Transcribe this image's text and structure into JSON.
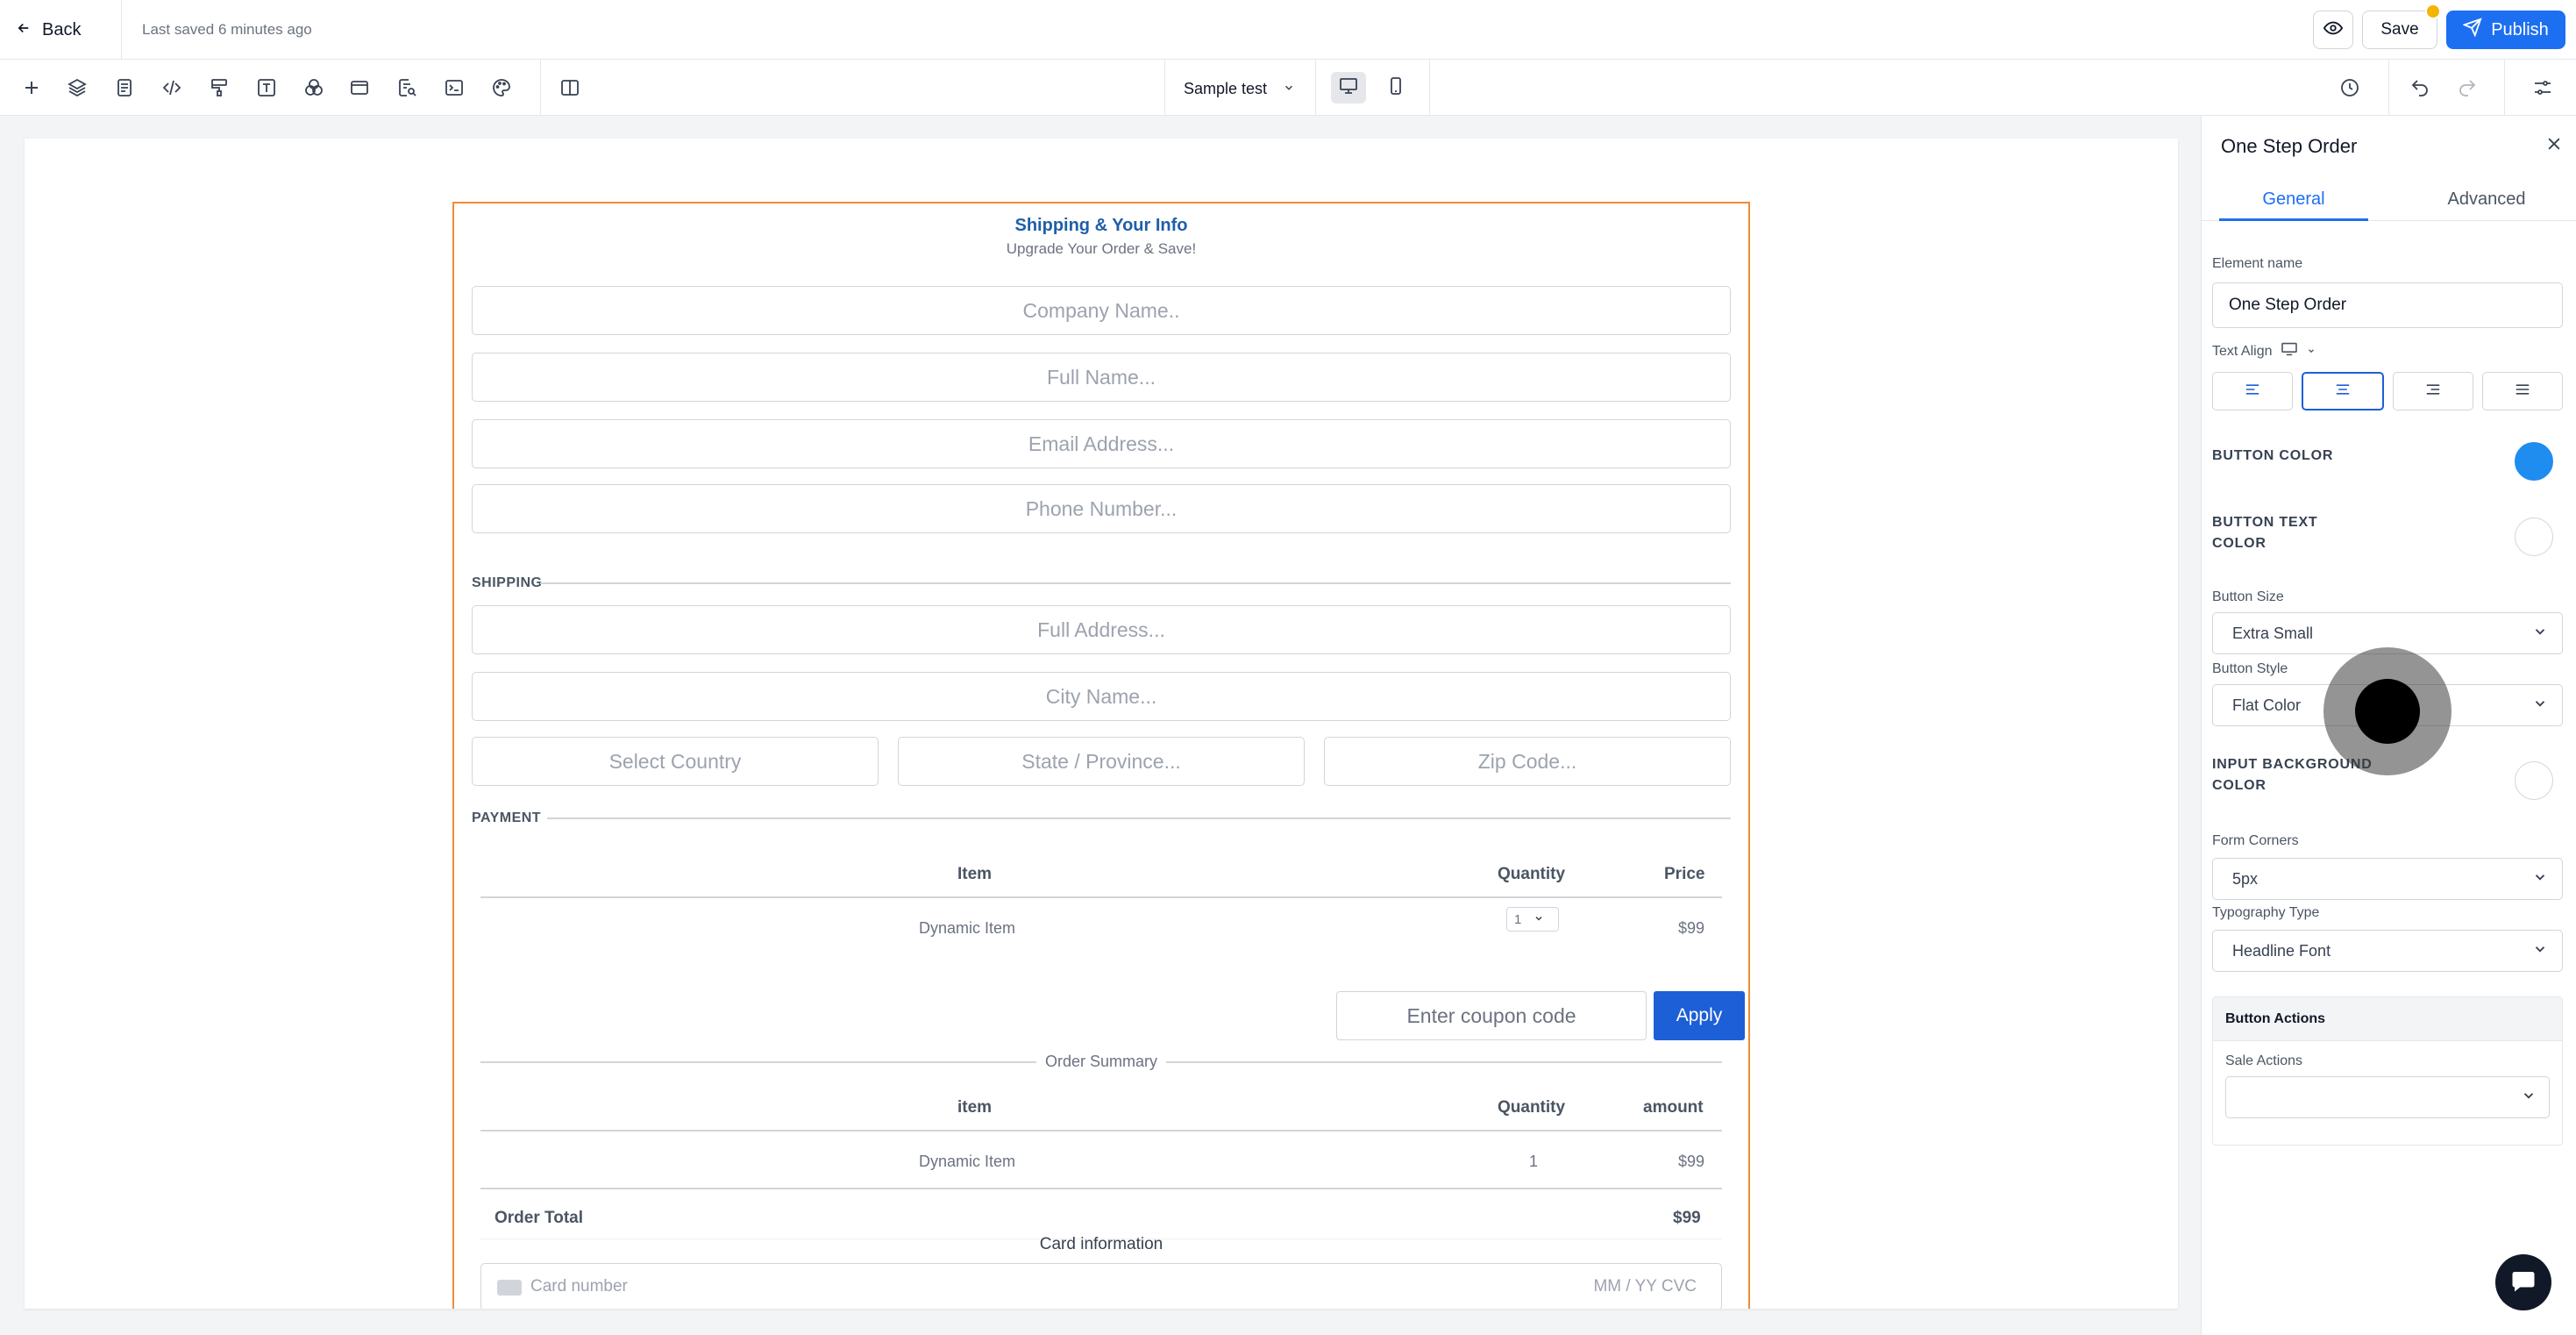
{
  "topbar": {
    "back_label": "Back",
    "last_saved": "Last saved 6 minutes ago",
    "save_label": "Save",
    "publish_label": "Publish"
  },
  "toolbar": {
    "tools": [
      "add-icon",
      "layers-icon",
      "page-icon",
      "code-icon",
      "paint-roller-icon",
      "text-icon",
      "colors-icon",
      "layout-icon",
      "search-page-icon",
      "terminal-icon",
      "palette-icon",
      "split-view-icon"
    ],
    "page_select": "Sample test",
    "devices": [
      "desktop-icon",
      "mobile-icon"
    ]
  },
  "form": {
    "title": "Shipping & Your Info",
    "subtitle": "Upgrade Your Order & Save!",
    "fields": {
      "company": "Company Name..",
      "full_name": "Full Name...",
      "email": "Email Address...",
      "phone": "Phone Number...",
      "address": "Full Address...",
      "city": "City Name...",
      "country": "Select Country",
      "state": "State / Province...",
      "zip": "Zip Code..."
    },
    "shipping_label": "SHIPPING",
    "payment_label": "PAYMENT",
    "items_table": {
      "headers": [
        "Item",
        "Quantity",
        "Price"
      ],
      "row": {
        "item": "Dynamic Item",
        "quantity": "1",
        "price": "$99"
      }
    },
    "coupon_placeholder": "Enter coupon code",
    "apply_label": "Apply",
    "order_summary_label": "Order Summary",
    "summary_table": {
      "headers": [
        "item",
        "Quantity",
        "amount"
      ],
      "row": {
        "item": "Dynamic Item",
        "quantity": "1",
        "amount": "$99"
      }
    },
    "order_total_label": "Order Total",
    "order_total_value": "$99",
    "card_info_label": "Card information",
    "card_number_placeholder": "Card number",
    "card_exp_placeholder": "MM / YY  CVC"
  },
  "panel": {
    "title": "One Step Order",
    "tabs": [
      "General",
      "Advanced"
    ],
    "element_name_label": "Element name",
    "element_name_value": "One Step Order",
    "text_align_label": "Text Align",
    "button_color_label": "BUTTON COLOR",
    "button_color": "#1f8cf0",
    "button_text_color_label_1": "BUTTON TEXT",
    "button_text_color_label_2": "COLOR",
    "button_text_color": "#ffffff",
    "button_size_label": "Button Size",
    "button_size_value": "Extra Small",
    "button_style_label": "Button Style",
    "button_style_value": "Flat Color",
    "input_bg_label_1": "INPUT BACKGROUND",
    "input_bg_label_2": "COLOR",
    "input_bg_color": "#ffffff",
    "form_corners_label": "Form Corners",
    "form_corners_value": "5px",
    "typography_label": "Typography Type",
    "typography_value": "Headline Font",
    "button_actions_label": "Button Actions",
    "sale_actions_label": "Sale Actions",
    "sale_actions_value": ""
  },
  "colors": {
    "accent": "#1d6ff2",
    "form_border": "#f08a3a",
    "title_blue": "#1f5fa8",
    "notification": "#f5b400"
  }
}
